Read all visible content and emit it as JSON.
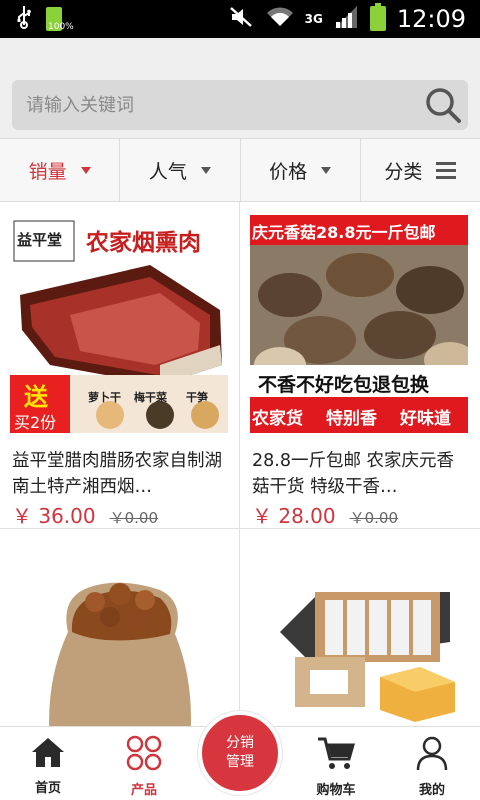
{
  "status_bar": {
    "battery_small_label": "100%",
    "network_label": "3G",
    "time": "12:09"
  },
  "search": {
    "placeholder": "请输入关键词"
  },
  "filters": [
    {
      "label": "销量",
      "icon": "triangle-down",
      "active": true
    },
    {
      "label": "人气",
      "icon": "triangle-down",
      "active": false
    },
    {
      "label": "价格",
      "icon": "triangle-down",
      "active": false
    },
    {
      "label": "分类",
      "icon": "menu",
      "active": false
    }
  ],
  "products": [
    {
      "title": "益平堂腊肉腊肠农家自制湖南土特产湘西烟…",
      "price": "￥ 36.00",
      "old_price": "￥0.00",
      "image": {
        "brand": "益平堂",
        "banner": "农家烟熏肉",
        "promo": "送",
        "promo_sub": "买2份",
        "items": [
          "萝卜干",
          "梅干菜",
          "干笋"
        ]
      }
    },
    {
      "title": "28.8一斤包邮 农家庆元香菇干货 特级干香…",
      "price": "￥ 28.00",
      "old_price": "￥0.00",
      "image": {
        "top_banner": "庆元香菇28.8元一斤包邮",
        "middle_banner": "不香不好吃包退包换",
        "bottom_tags": [
          "农家货",
          "特别香",
          "好味道"
        ]
      }
    },
    {
      "title": "",
      "price": "",
      "old_price": "",
      "image": {
        "subject": "sack-of-dried-mushrooms"
      }
    },
    {
      "title": "",
      "price": "",
      "old_price": "",
      "image": {
        "subject": "boxed-pastries"
      }
    }
  ],
  "bottom_nav": {
    "items": [
      {
        "label": "首页",
        "icon": "home-icon",
        "active": false
      },
      {
        "label": "产品",
        "icon": "grid-icon",
        "active": true
      },
      {
        "label": "购物车",
        "icon": "cart-icon",
        "active": false
      },
      {
        "label": "我的",
        "icon": "user-icon",
        "active": false
      }
    ],
    "center_button": {
      "line1": "分销",
      "line2": "管理"
    }
  },
  "colors": {
    "accent": "#d0343c",
    "background": "#efefef",
    "battery": "#8bd13a"
  }
}
